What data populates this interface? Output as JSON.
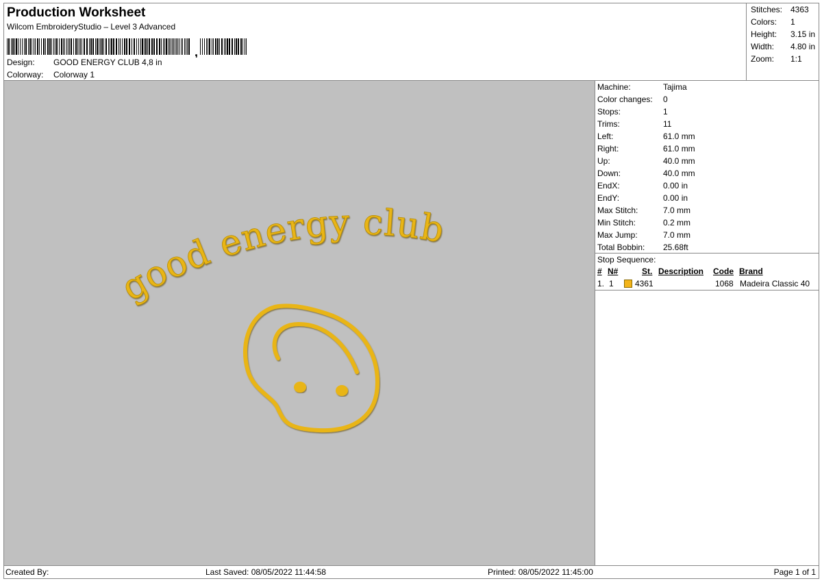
{
  "header": {
    "title": "Production Worksheet",
    "software": "Wilcom EmbroideryStudio – Level 3 Advanced",
    "design_label": "Design:",
    "design_value": "GOOD ENERGY CLUB 4,8 in",
    "colorway_label": "Colorway:",
    "colorway_value": "Colorway 1"
  },
  "stats": [
    {
      "label": "Stitches:",
      "value": "4363"
    },
    {
      "label": "Colors:",
      "value": "1"
    },
    {
      "label": "Height:",
      "value": "3.15 in"
    },
    {
      "label": "Width:",
      "value": "4.80 in"
    },
    {
      "label": "Zoom:",
      "value": "1:1"
    }
  ],
  "machine_info": [
    {
      "label": "Machine:",
      "value": "Tajima"
    },
    {
      "label": "Color changes:",
      "value": "0"
    },
    {
      "label": "Stops:",
      "value": "1"
    },
    {
      "label": "Trims:",
      "value": "11"
    },
    {
      "label": "Left:",
      "value": "61.0 mm"
    },
    {
      "label": "Right:",
      "value": "61.0 mm"
    },
    {
      "label": "Up:",
      "value": "40.0 mm"
    },
    {
      "label": "Down:",
      "value": "40.0 mm"
    },
    {
      "label": "EndX:",
      "value": "0.00 in"
    },
    {
      "label": "EndY:",
      "value": "0.00 in"
    },
    {
      "label": "Max Stitch:",
      "value": "7.0 mm"
    },
    {
      "label": "Min Stitch:",
      "value": "0.2 mm"
    },
    {
      "label": "Max Jump:",
      "value": "7.0 mm"
    },
    {
      "label": "Total Bobbin:",
      "value": "25.68ft"
    }
  ],
  "stop_sequence": {
    "title": "Stop Sequence:",
    "columns": {
      "num": "#",
      "n": "N#",
      "st": "St.",
      "description": "Description",
      "code": "Code",
      "brand": "Brand"
    },
    "rows": [
      {
        "num": "1.",
        "n": "1",
        "st": "4361",
        "description": "",
        "code": "1068",
        "brand": "Madeira Classic 40",
        "color": "#f3b41a"
      }
    ]
  },
  "artwork": {
    "text": "good energy club",
    "thread_color": "#e9b515",
    "background": "#c0c0c0"
  },
  "footer": {
    "created_by": "Created By:",
    "last_saved": "Last Saved: 08/05/2022 11:44:58",
    "printed": "Printed: 08/05/2022 11:45:00",
    "page": "Page 1 of 1"
  }
}
